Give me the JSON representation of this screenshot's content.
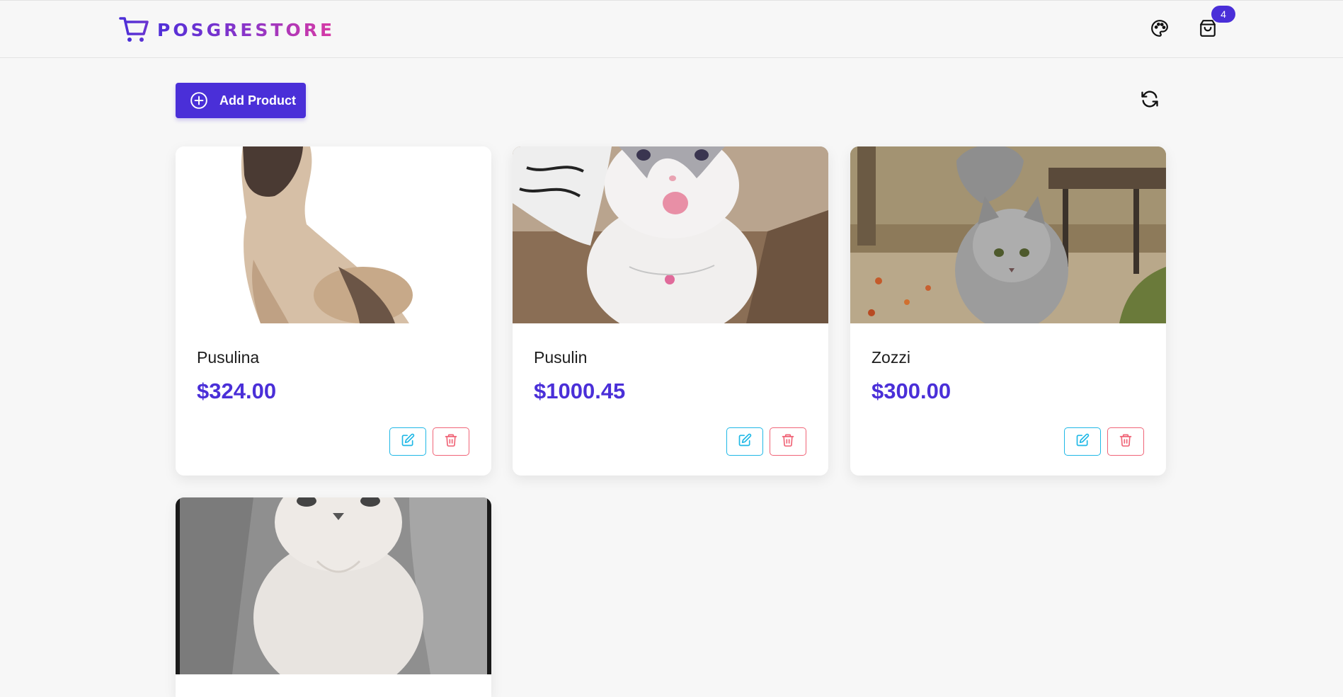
{
  "brand": {
    "name": "POSGRESTORE",
    "icon": "cart-icon"
  },
  "header": {
    "theme_icon": "palette-icon",
    "cart_icon": "shopping-bag-icon",
    "cart_count": "4"
  },
  "toolbar": {
    "add_label": "Add Product",
    "add_icon": "plus-circle-icon",
    "refresh_icon": "refresh-icon"
  },
  "colors": {
    "accent": "#4a2fd8",
    "edit": "#1fb8e6",
    "delete": "#f06477"
  },
  "products": [
    {
      "name": "Pusulina",
      "price": "$324.00",
      "image": "siamese-cat-photo"
    },
    {
      "name": "Pusulin",
      "price": "$1000.45",
      "image": "white-fluffy-cat-photo"
    },
    {
      "name": "Zozzi",
      "price": "$300.00",
      "image": "gray-longhair-cat-photo"
    },
    {
      "name": "",
      "price": "",
      "image": "white-kitten-photo"
    }
  ]
}
